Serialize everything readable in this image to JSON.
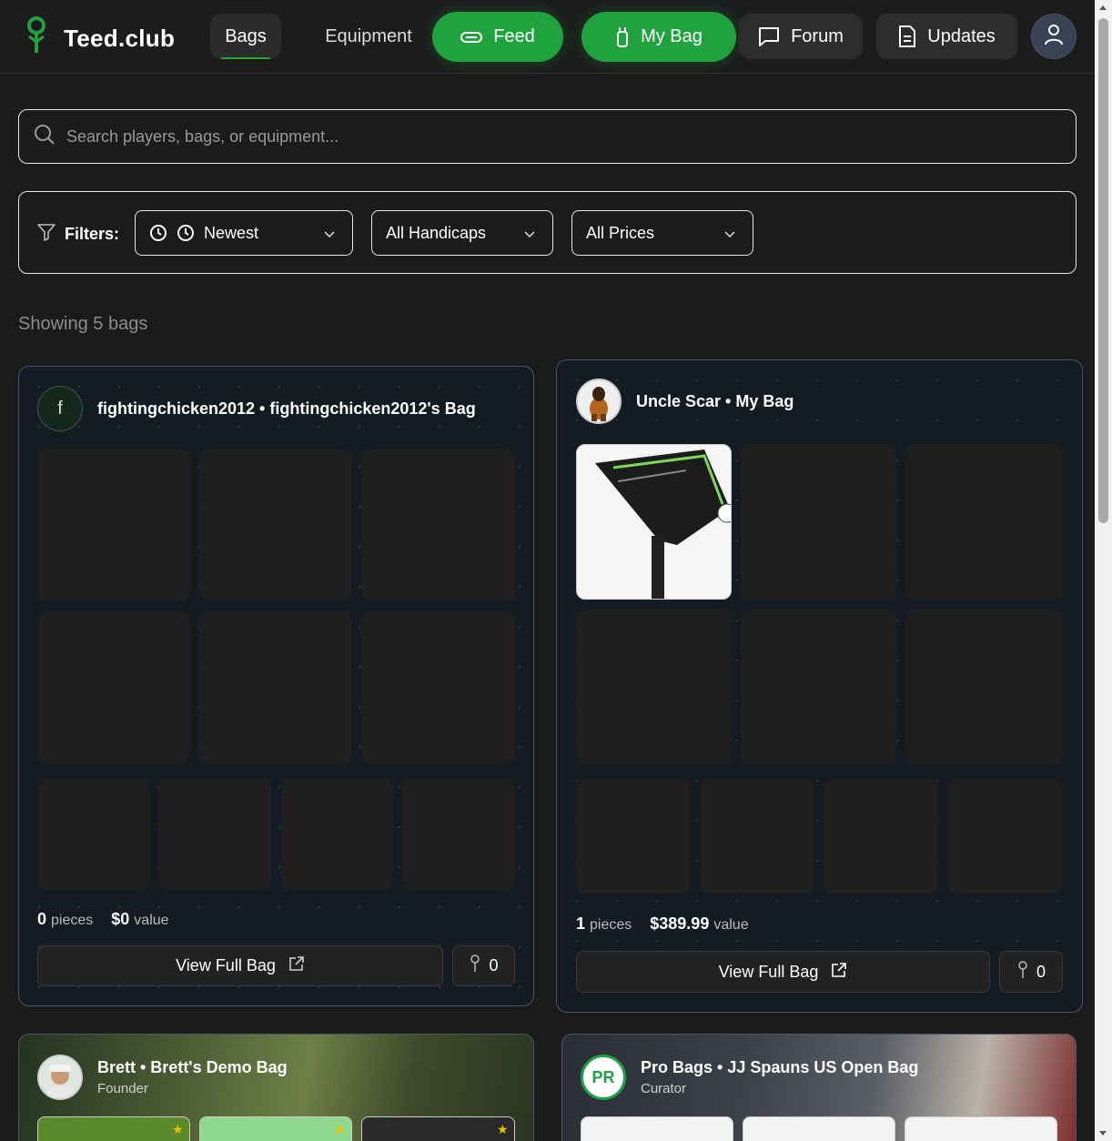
{
  "app": {
    "name": "Teed.club"
  },
  "nav": {
    "bags": "Bags",
    "equipment": "Equipment",
    "feed": "Feed",
    "my_bag": "My Bag",
    "forum": "Forum",
    "updates": "Updates"
  },
  "search": {
    "placeholder": "Search players, bags, or equipment..."
  },
  "filters": {
    "label": "Filters:",
    "sort": "Newest",
    "handicap": "All Handicaps",
    "price": "All Prices"
  },
  "results": {
    "showing": "Showing 5 bags"
  },
  "cards": [
    {
      "title": "fightingchicken2012 • fightingchicken2012's Bag",
      "avatar_letter": "f",
      "pieces_count": "0",
      "pieces_label": "pieces",
      "value_amount": "$0",
      "value_label": "value",
      "view_label": "View Full Bag",
      "tee_count": "0"
    },
    {
      "title": "Uncle Scar • My Bag",
      "pieces_count": "1",
      "pieces_label": "pieces",
      "value_amount": "$389.99",
      "value_label": "value",
      "view_label": "View Full Bag",
      "tee_count": "0"
    },
    {
      "title": "Brett • Brett's Demo Bag",
      "subtitle": "Founder"
    },
    {
      "title": "Pro Bags • JJ Spauns US Open Bag",
      "subtitle": "Curator",
      "logo_text": "PR"
    }
  ],
  "colors": {
    "accent_green": "#20a33f",
    "background": "#1b1b1b",
    "card_border": "#4a5566"
  },
  "icons": [
    "tee-logo-icon",
    "golf-ball-icon",
    "bag-icon",
    "chat-icon",
    "document-icon",
    "user-icon",
    "search-icon",
    "filter-icon",
    "clock-icon",
    "chevron-down-icon",
    "external-link-icon",
    "tee-icon",
    "star-icon"
  ]
}
